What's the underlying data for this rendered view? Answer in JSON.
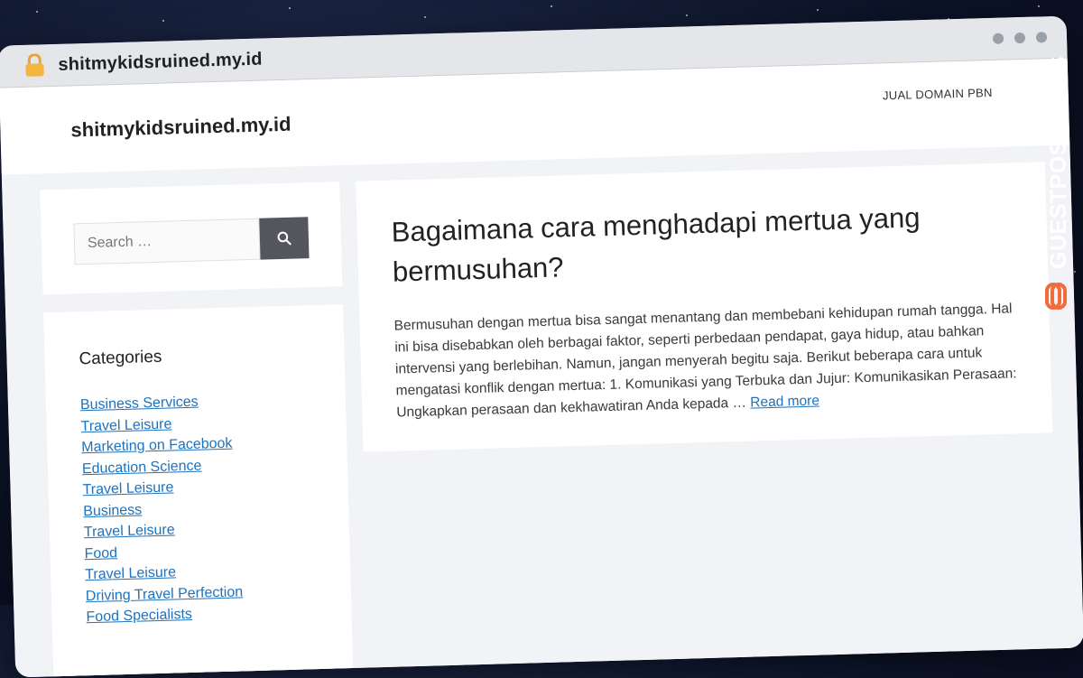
{
  "browser": {
    "url": "shitmykidsruined.my.id"
  },
  "header": {
    "site_title": "shitmykidsruined.my.id",
    "nav_item": "JUAL DOMAIN PBN"
  },
  "sidebar": {
    "search_placeholder": "Search …",
    "categories_title": "Categories",
    "categories": [
      "Business Services",
      "Travel Leisure",
      "Marketing on Facebook",
      "Education Science",
      "Travel Leisure",
      "Business",
      "Travel Leisure",
      "Food",
      "Travel Leisure",
      "Driving Travel Perfection",
      "Food Specialists"
    ]
  },
  "post": {
    "title": "Bagaimana cara menghadapi mertua yang bermusuhan?",
    "excerpt": "Bermusuhan dengan mertua bisa sangat menantang dan membebani kehidupan rumah tangga. Hal ini bisa disebabkan oleh berbagai faktor, seperti perbedaan pendapat, gaya hidup, atau bahkan intervensi yang berlebihan. Namun, jangan menyerah begitu saja. Berikut beberapa cara untuk mengatasi konflik dengan mertua: 1. Komunikasi yang Terbuka dan Jujur: Komunikasikan Perasaan: Ungkapkan perasaan dan kekhawatiran Anda kepada …",
    "read_more": "Read more"
  },
  "watermark": {
    "text": "GUESTPOSTLINKS",
    "color": "#f26b3a"
  }
}
